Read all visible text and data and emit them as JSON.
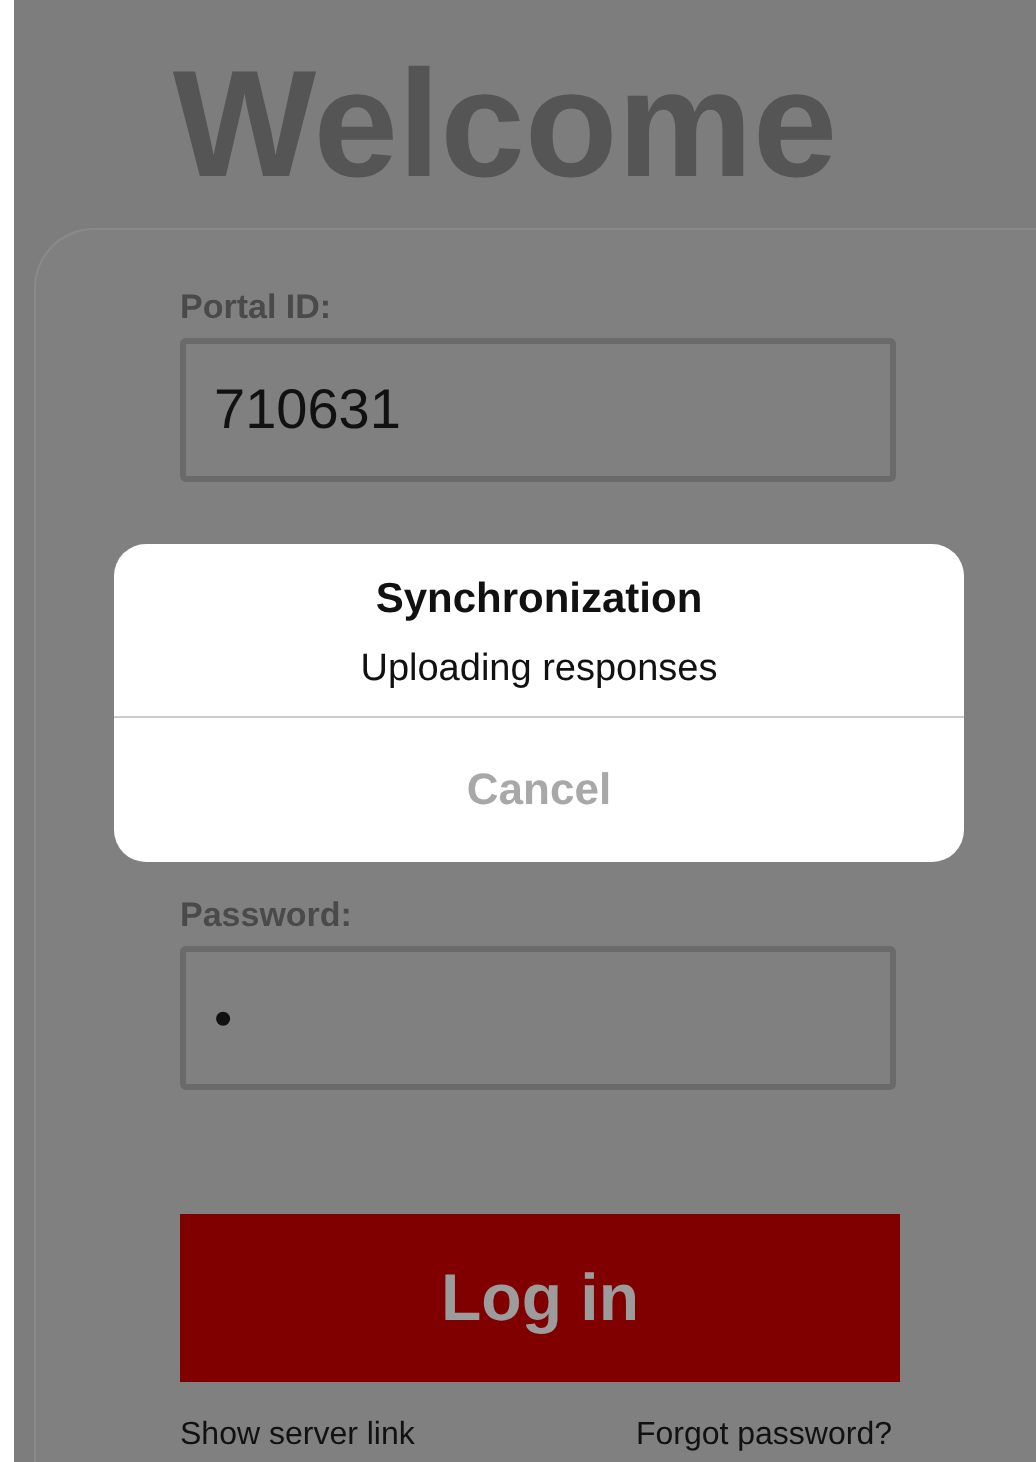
{
  "title": "Welcome",
  "form": {
    "portal_id": {
      "label": "Portal ID:",
      "value": "710631"
    },
    "password": {
      "label": "Password:",
      "value": "•"
    },
    "login_button": "Log in",
    "links": [
      "Show server link",
      "Forgot password?"
    ]
  },
  "dialog": {
    "title": "Synchronization",
    "message": "Uploading responses",
    "button": {
      "label": "Cancel",
      "disabled": true
    }
  }
}
